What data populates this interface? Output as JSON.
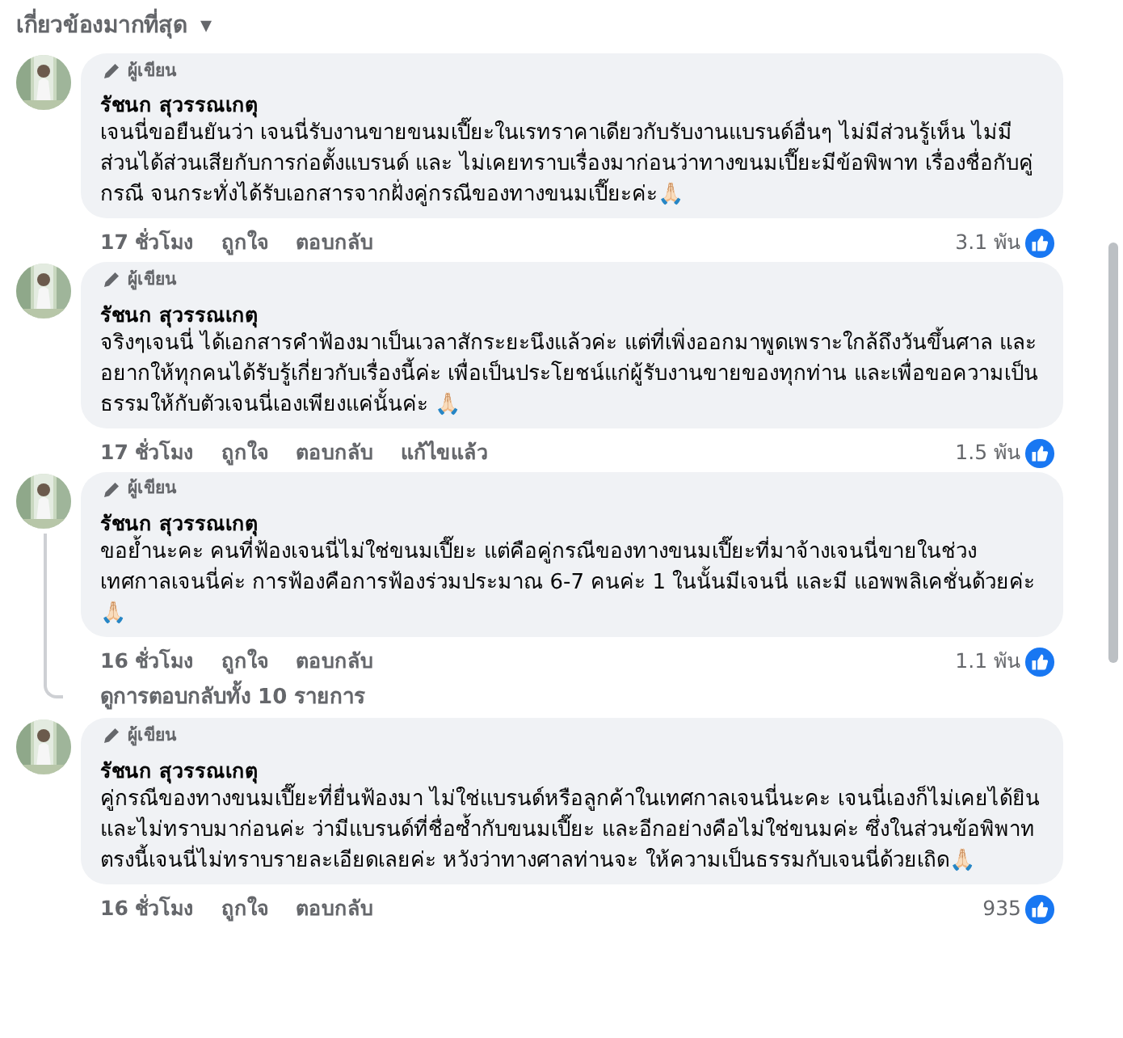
{
  "sort_menu": {
    "label": "เกี่ยวข้องมากที่สุด",
    "caret": "▾"
  },
  "comments": [
    {
      "author_badge": "ผู้เขียน",
      "author": "รัชนก สุวรรณเกตุ",
      "text": "เจนนี่ขอยืนยันว่า เจนนี่รับงานขายขนมเปี๊ยะในเรทราคาเดียวกับรับงานแบรนด์อื่นๆ ไม่มีส่วนรู้เห็น ไม่มีส่วนได้ส่วนเสียกับการก่อตั้งแบรนด์ และ ไม่เคยทราบเรื่องมาก่อนว่าทางขนมเปี๊ยะมีข้อพิพาท เรื่องชื่อกับคู่กรณี จนกระทั่งได้รับเอกสารจากฝั่งคู่กรณีของทางขนมเปี๊ยะค่ะ🙏🏻",
      "time": "17 ชั่วโมง",
      "actions": [
        "ถูกใจ",
        "ตอบกลับ"
      ],
      "likes": "3.1 พัน"
    },
    {
      "author_badge": "ผู้เขียน",
      "author": "รัชนก สุวรรณเกตุ",
      "text": "จริงๆเจนนี่ ได้เอกสารคำฟ้องมาเป็นเวลาสักระยะนึงแล้วค่ะ แต่ที่เพิ่งออกมาพูดเพราะใกล้ถึงวันขึ้นศาล และอยากให้ทุกคนได้รับรู้เกี่ยวกับเรื่องนี้ค่ะ เพื่อเป็นประโยชน์แก่ผู้รับงานขายของทุกท่าน และเพื่อขอความเป็นธรรมให้กับตัวเจนนี่เองเพียงแค่นั้นค่ะ 🙏🏻",
      "time": "17 ชั่วโมง",
      "actions": [
        "ถูกใจ",
        "ตอบกลับ"
      ],
      "edited": "แก้ไขแล้ว",
      "likes": "1.5 พัน"
    },
    {
      "author_badge": "ผู้เขียน",
      "author": "รัชนก สุวรรณเกตุ",
      "text": "ขอย้ำนะคะ คนที่ฟ้องเจนนี่ไม่ใช่ขนมเปี๊ยะ แต่คือคู่กรณีของทางขนมเปี๊ยะที่มาจ้างเจนนี่ขายในช่วงเทศกาลเจนนี่ค่ะ การฟ้องคือการฟ้องร่วมประมาณ 6-7 คนค่ะ 1 ในนั้นมีเจนนี่ และมี แอพพลิเคชั่นด้วยค่ะ 🙏🏻",
      "time": "16 ชั่วโมง",
      "actions": [
        "ถูกใจ",
        "ตอบกลับ"
      ],
      "likes": "1.1 พัน",
      "replies_link": "ดูการตอบกลับทั้ง 10 รายการ"
    },
    {
      "author_badge": "ผู้เขียน",
      "author": "รัชนก สุวรรณเกตุ",
      "text": "คู่กรณีของทางขนมเปี๊ยะที่ยื่นฟ้องมา ไม่ใช่แบรนด์หรือลูกค้าในเทศกาลเจนนี่นะคะ เจนนี่เองก็ไม่เคยได้ยินและไม่ทราบมาก่อนค่ะ ว่ามีแบรนด์ที่ชื่อซ้ำกับขนมเปี๊ยะ และอีกอย่างคือไม่ใช่ขนมค่ะ ซึ่งในส่วนข้อพิพาทตรงนี้เจนนี่ไม่ทราบรายละเอียดเลยค่ะ หวังว่าทางศาลท่านจะ ให้ความเป็นธรรมกับเจนนี่ด้วยเถิด🙏🏻",
      "time": "16 ชั่วโมง",
      "actions": [
        "ถูกใจ",
        "ตอบกลับ"
      ],
      "likes": "935"
    }
  ]
}
